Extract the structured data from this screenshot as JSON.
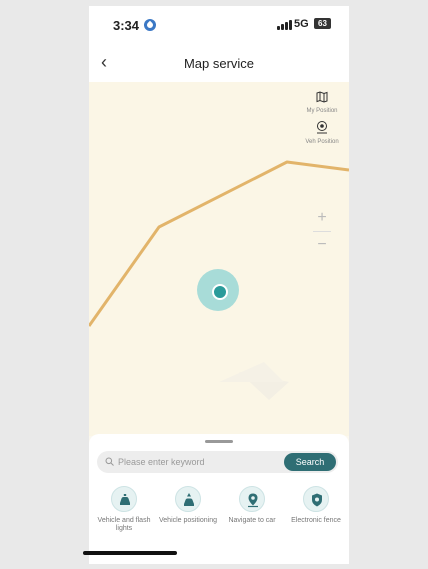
{
  "status_bar": {
    "time": "3:34",
    "network": "5G",
    "battery": "63"
  },
  "header": {
    "back_icon": "chevron-left-icon",
    "title": "Map service"
  },
  "map_tools": [
    {
      "icon": "map-icon",
      "label": "My Position"
    },
    {
      "icon": "vehicle-locate-icon",
      "label": "Veh Position"
    }
  ],
  "zoom": {
    "in": "+",
    "out": "−"
  },
  "search": {
    "placeholder": "Please enter keyword",
    "button": "Search"
  },
  "actions": [
    {
      "icon": "car-icon",
      "label": "Vehicle and flash lights"
    },
    {
      "icon": "car-locate-icon",
      "label": "Vehicle positioning"
    },
    {
      "icon": "navigate-icon",
      "label": "Navigate to car"
    },
    {
      "icon": "shield-icon",
      "label": "Electronic fence"
    }
  ],
  "colors": {
    "accent": "#2f6e74",
    "road": "#e2b46a",
    "map_bg": "#fbf6e6",
    "location": "#2b9b9a"
  }
}
